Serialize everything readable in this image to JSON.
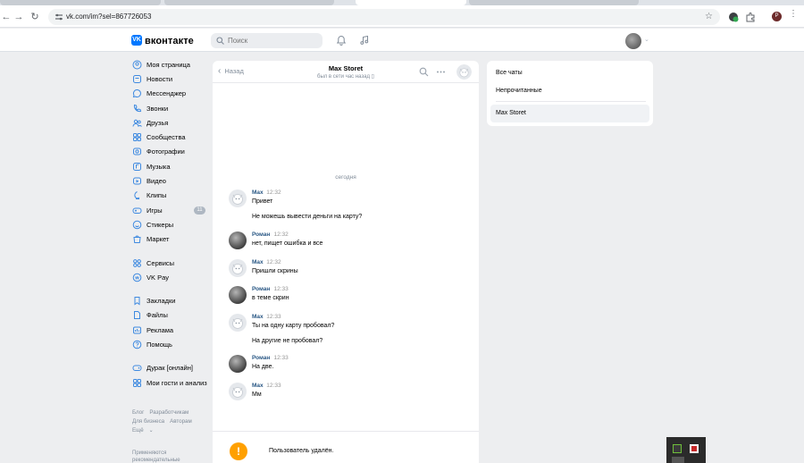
{
  "browser": {
    "url": "vk.com/im?sel=867726053",
    "profile_initial": "P"
  },
  "header": {
    "brand": "вконтакте",
    "logo_text": "VK",
    "search_placeholder": "Поиск"
  },
  "sidebar": {
    "items": [
      {
        "label": "Моя страница",
        "icon": "profile-icon"
      },
      {
        "label": "Новости",
        "icon": "news-icon"
      },
      {
        "label": "Мессенджер",
        "icon": "messenger-icon"
      },
      {
        "label": "Звонки",
        "icon": "phone-icon"
      },
      {
        "label": "Друзья",
        "icon": "friends-icon"
      },
      {
        "label": "Сообщества",
        "icon": "communities-icon"
      },
      {
        "label": "Фотографии",
        "icon": "photos-icon"
      },
      {
        "label": "Музыка",
        "icon": "music-icon"
      },
      {
        "label": "Видео",
        "icon": "video-icon"
      },
      {
        "label": "Клипы",
        "icon": "clips-icon"
      },
      {
        "label": "Игры",
        "icon": "games-icon",
        "badge": "11"
      },
      {
        "label": "Стикеры",
        "icon": "stickers-icon"
      },
      {
        "label": "Маркет",
        "icon": "market-icon"
      }
    ],
    "items2": [
      {
        "label": "Сервисы",
        "icon": "services-icon"
      },
      {
        "label": "VK Pay",
        "icon": "vkpay-icon"
      }
    ],
    "items3": [
      {
        "label": "Закладки",
        "icon": "bookmarks-icon"
      },
      {
        "label": "Файлы",
        "icon": "files-icon"
      },
      {
        "label": "Реклама",
        "icon": "ads-icon"
      },
      {
        "label": "Помощь",
        "icon": "help-icon"
      }
    ],
    "items4": [
      {
        "label": "Дурак [онлайн]",
        "icon": "gamepad-icon"
      },
      {
        "label": "Мои гости и анализ",
        "icon": "apps-icon"
      }
    ],
    "footer": {
      "blog": "Блог",
      "developers": "Разработчикам",
      "business": "Для бизнеса",
      "authors": "Авторам",
      "more": "Ещё",
      "note": "Применяются рекомендательные"
    }
  },
  "chat": {
    "back_label": "Назад",
    "peer_name": "Max Storet",
    "peer_status": "был в сети час назад",
    "day_label": "сегодня",
    "messages": [
      {
        "author": "Max",
        "time": "12:32",
        "lines": [
          "Привет",
          "Не можешь вывести деньги на карту?"
        ],
        "avatar": "dog"
      },
      {
        "author": "Роман",
        "time": "12:32",
        "lines": [
          "нет, пищет ошибка и все"
        ],
        "avatar": "dark"
      },
      {
        "author": "Max",
        "time": "12:32",
        "lines": [
          "Пришли скрины"
        ],
        "avatar": "dog"
      },
      {
        "author": "Роман",
        "time": "12:33",
        "lines": [
          "в теме скрин"
        ],
        "avatar": "dark"
      },
      {
        "author": "Max",
        "time": "12:33",
        "lines": [
          "Ты на одну карту пробовал?",
          "На другие не пробовал?"
        ],
        "avatar": "dog"
      },
      {
        "author": "Роман",
        "time": "12:33",
        "lines": [
          "На две."
        ],
        "avatar": "dark"
      },
      {
        "author": "Max",
        "time": "12:33",
        "lines": [
          "Мм"
        ],
        "avatar": "dog"
      }
    ],
    "deleted_notice": "Пользователь удалён."
  },
  "folders": {
    "all": "Все чаты",
    "unread": "Непрочитанные",
    "active": "Max Storet"
  }
}
